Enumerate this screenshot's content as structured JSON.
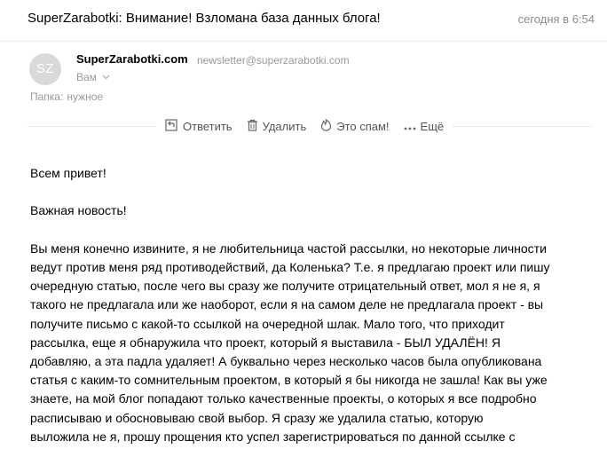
{
  "email": {
    "subject": "SuperZarabotki: Внимание! Взломана база данных блога!",
    "date": "сегодня в 6:54",
    "sender": {
      "avatar_initials": "SZ",
      "name": "SuperZarabotki.com",
      "email": "newsletter@superzarabotki.com",
      "recipient": "Вам"
    },
    "folder": {
      "label": "Папка:",
      "value": "нужное"
    }
  },
  "toolbar": {
    "reply_label": "Ответить",
    "delete_label": "Удалить",
    "spam_label": "Это спам!",
    "more_label": "Ещё"
  },
  "body": {
    "greeting": "Всем привет!",
    "news": "Важная новость!",
    "lines": [
      "Вы меня конечно извините, я не любительница частой рассылки, но некоторые личности",
      "ведут против меня ряд противодействий, да Коленька? Т.е. я предлагаю проект или пишу",
      "очередную статью, после чего вы сразу же получите отрицательный ответ, мол я не я, я",
      "такого не предлагала или же наоборот, если я на самом деле не предлагала проект - вы",
      "получите письмо с какой-то ссылкой на очередной шлак. Мало того, что приходит",
      "рассылка,  еще я обнаружила что проект, который я выставила - БЫЛ УДАЛЁН! Я",
      "добавляю, а эта падла удаляет! А буквально через несколько часов была опубликована",
      "статья с каким-то сомнительным проектом, в который я бы никогда не зашла! Как вы уже",
      "знаете, на мой блог попадают только качественные проекты, о которых я все подробно",
      "расписываю и обосновываю свой выбор.  Я сразу же удалила статью, которую",
      "выложила не я, прошу прощения кто успел зарегистрироваться по данной ссылке с"
    ]
  },
  "colors": {
    "muted_text": "#999999",
    "toolbar_text": "#555555",
    "avatar_bg": "#d9d9d9",
    "divider": "#e8e8e8"
  },
  "icons": {
    "reply": "reply-icon",
    "delete": "trash-icon",
    "spam": "flame-icon",
    "more": "more-dots-icon",
    "recipient_expand": "chevron-down-icon"
  }
}
